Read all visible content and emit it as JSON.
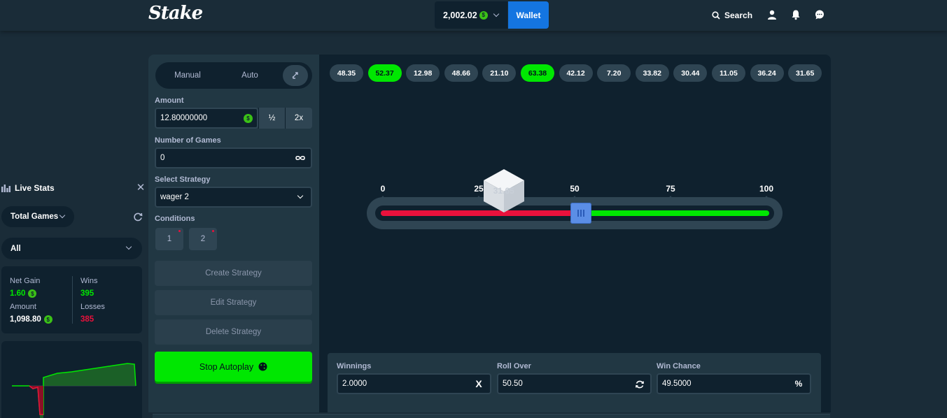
{
  "header": {
    "logo": "Stake",
    "balance": "2,002.02",
    "currency_icon": "coin-icon",
    "wallet_label": "Wallet",
    "search_label": "Search",
    "icons": [
      "user-icon",
      "bell-icon",
      "chat-icon"
    ]
  },
  "live_stats": {
    "title": "Live Stats",
    "filter_games": "Total Games",
    "filter_scope": "All",
    "net_gain_label": "Net Gain",
    "net_gain_value": "1.60",
    "amount_label": "Amount",
    "amount_value": "1,098.80",
    "wins_label": "Wins",
    "wins_value": "395",
    "losses_label": "Losses",
    "losses_value": "385"
  },
  "controls": {
    "tab_manual": "Manual",
    "tab_auto": "Auto",
    "amount_label": "Amount",
    "amount_value": "12.80000000",
    "half_label": "½",
    "double_label": "2x",
    "games_label": "Number of Games",
    "games_value": "0",
    "strategy_label": "Select Strategy",
    "strategy_value": "wager 2",
    "conditions_label": "Conditions",
    "condition_1": "1",
    "condition_2": "2",
    "create_label": "Create Strategy",
    "edit_label": "Edit Strategy",
    "delete_label": "Delete Strategy",
    "stop_label": "Stop Autoplay"
  },
  "history": [
    {
      "value": "48.35",
      "win": false
    },
    {
      "value": "52.37",
      "win": true
    },
    {
      "value": "12.98",
      "win": false
    },
    {
      "value": "48.66",
      "win": false
    },
    {
      "value": "21.10",
      "win": false
    },
    {
      "value": "63.38",
      "win": true
    },
    {
      "value": "42.12",
      "win": false
    },
    {
      "value": "7.20",
      "win": false
    },
    {
      "value": "33.82",
      "win": false
    },
    {
      "value": "30.44",
      "win": false
    },
    {
      "value": "11.05",
      "win": false
    },
    {
      "value": "36.24",
      "win": false
    },
    {
      "value": "31.65",
      "win": false
    }
  ],
  "slider": {
    "ticks": [
      "0",
      "25",
      "50",
      "75",
      "100"
    ],
    "roll_over": 50.5,
    "last_roll": 31.65,
    "last_roll_label": "31.65"
  },
  "bet_panel": {
    "winnings_label": "Winnings",
    "winnings_value": "2.0000",
    "winnings_suffix": "X",
    "roll_over_label": "Roll Over",
    "roll_over_value": "50.50",
    "win_chance_label": "Win Chance",
    "win_chance_value": "49.5000",
    "win_chance_suffix": "%"
  },
  "colors": {
    "bg": "#1a2c38",
    "panel": "#213743",
    "dark": "#0f212e",
    "green": "#00e701",
    "red": "#e9113c",
    "blue": "#1475e1"
  }
}
